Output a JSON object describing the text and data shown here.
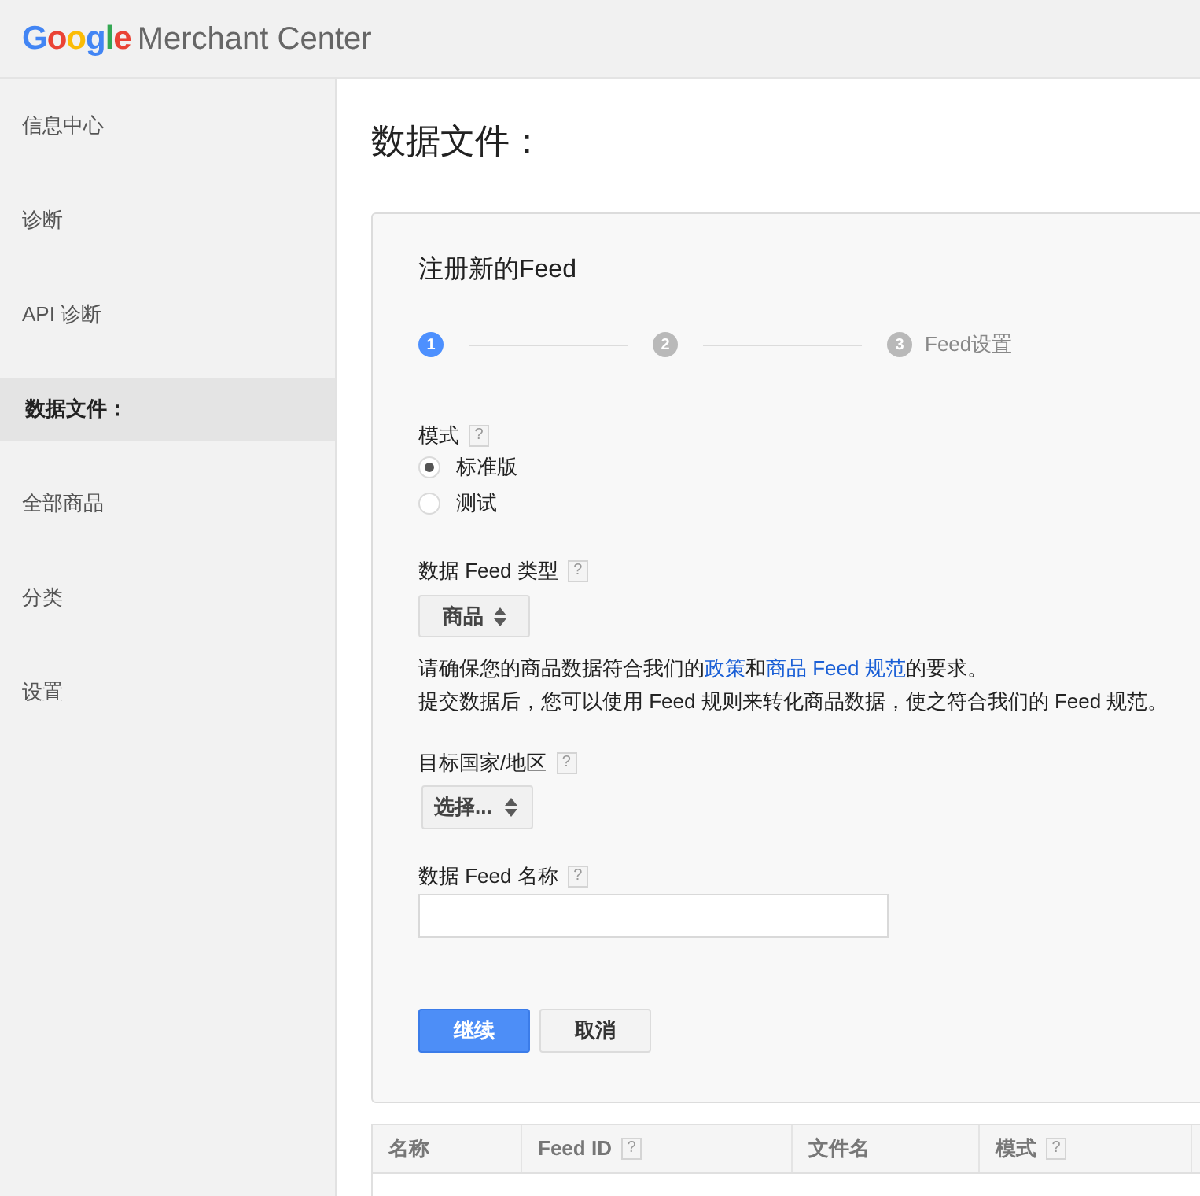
{
  "header": {
    "logo_brand": "Google",
    "logo_product": "Merchant Center"
  },
  "sidebar": {
    "items": [
      {
        "label": "信息中心",
        "selected": false
      },
      {
        "label": "诊断",
        "selected": false
      },
      {
        "label": "API 诊断",
        "selected": false
      },
      {
        "label": "数据文件：",
        "selected": true
      },
      {
        "label": "全部商品",
        "selected": false
      },
      {
        "label": "分类",
        "selected": false
      },
      {
        "label": "设置",
        "selected": false
      }
    ]
  },
  "page_title": "数据文件：",
  "form": {
    "title": "注册新的Feed",
    "steps": [
      {
        "number": "1",
        "selected": true
      },
      {
        "number": "2",
        "selected": false
      },
      {
        "number": "3",
        "label": "Feed设置",
        "selected": false
      }
    ],
    "mode": {
      "label": "模式",
      "help": "?",
      "options": [
        {
          "label": "标准版",
          "selected": true
        },
        {
          "label": "测试",
          "selected": false
        }
      ]
    },
    "feed_type": {
      "label": "数据 Feed 类型",
      "help": "?",
      "value": "商品"
    },
    "notice": [
      {
        "parts": [
          {
            "kind": "text",
            "text": "请确保您的商品数据符合我们的"
          },
          {
            "kind": "link",
            "text": "政策"
          },
          {
            "kind": "text",
            "text": "和"
          },
          {
            "kind": "link",
            "text": "商品 Feed 规范"
          },
          {
            "kind": "text",
            "text": "的要求。"
          }
        ]
      },
      {
        "parts": [
          {
            "kind": "text",
            "text": "提交数据后，您可以使用 Feed 规则来转化商品数据，使之符合我们的 Feed 规范。"
          }
        ]
      }
    ],
    "target_country": {
      "label": "目标国家/地区",
      "help": "?",
      "value": "选择..."
    },
    "feed_name": {
      "label": "数据 Feed 名称",
      "help": "?"
    },
    "buttons": [
      {
        "label": "继续",
        "kind": "primary"
      },
      {
        "label": "取消",
        "kind": "secondary"
      }
    ]
  },
  "table": {
    "columns": [
      {
        "label": "名称"
      },
      {
        "label": "Feed ID",
        "help": "?"
      },
      {
        "label": "文件名"
      },
      {
        "label": "模式",
        "help": "?"
      }
    ]
  }
}
